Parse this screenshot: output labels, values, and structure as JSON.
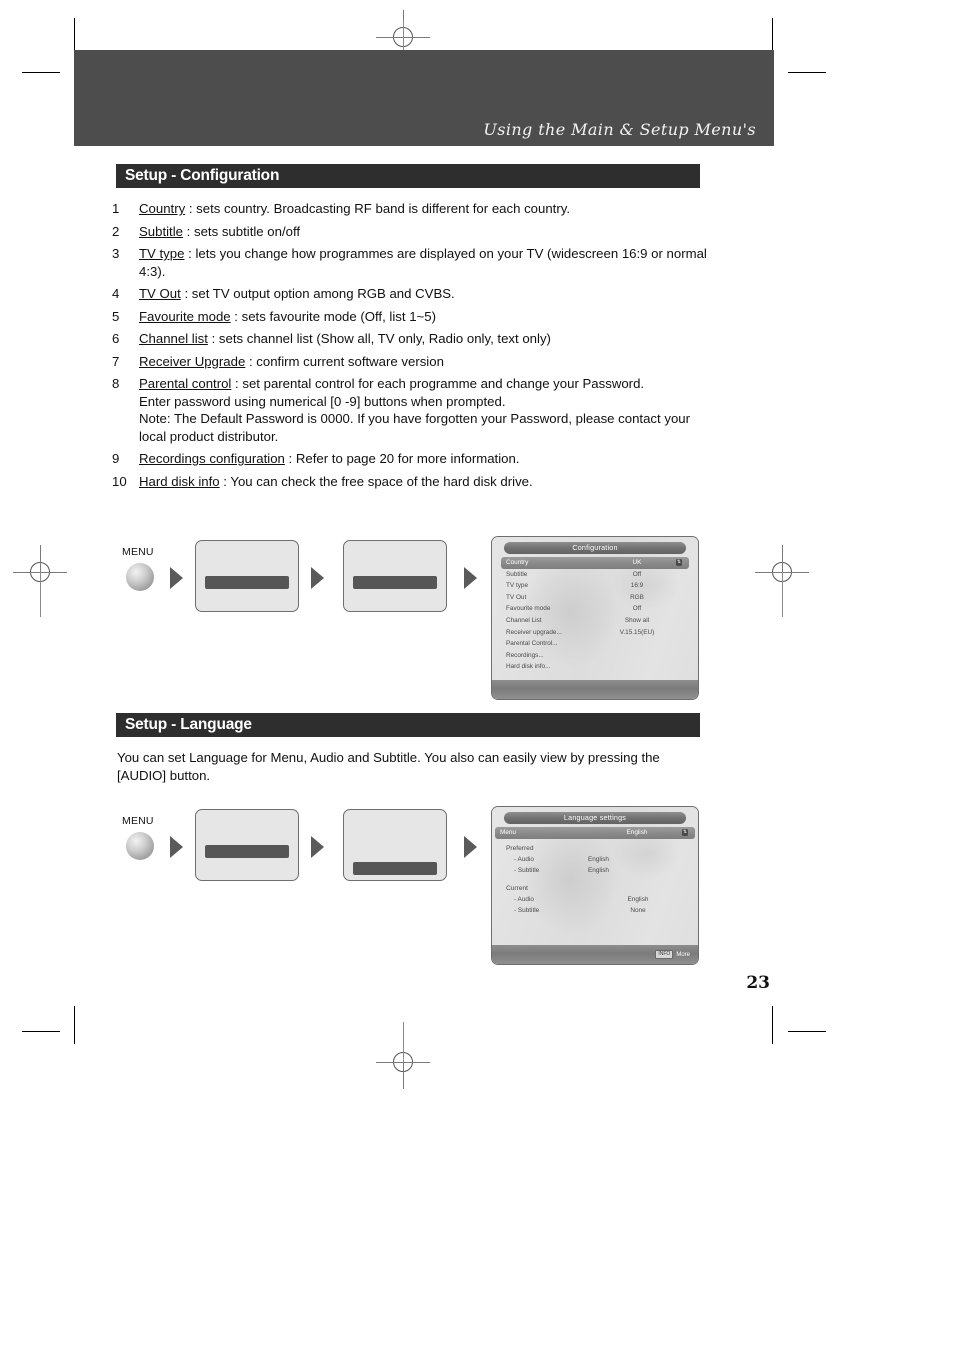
{
  "header": {
    "title": "Using the Main & Setup Menu's"
  },
  "sections": {
    "configuration": {
      "heading": "Setup - Configuration",
      "items": [
        {
          "num": "1",
          "term": "Country",
          "rest": " : sets country.  Broadcasting RF band is different for each country."
        },
        {
          "num": "2",
          "term": "Subtitle",
          "rest": " : sets subtitle on/off"
        },
        {
          "num": "3",
          "term": "TV type",
          "rest": " : lets you change how programmes are displayed on your TV (widescreen 16:9 or normal 4:3)."
        },
        {
          "num": "4",
          "term": "TV Out",
          "rest": " : set TV output option among RGB and CVBS."
        },
        {
          "num": "5",
          "term": "Favourite mode",
          "rest": " : sets favourite mode (Off, list 1~5)"
        },
        {
          "num": "6",
          "term": "Channel list",
          "rest": " : sets channel list (Show all, TV only, Radio only, text only)"
        },
        {
          "num": "7",
          "term": "Receiver Upgrade",
          "rest": " : confirm current software version"
        },
        {
          "num": "8",
          "term": "Parental control",
          "rest": " : set parental control for each programme and change your Password.",
          "extra": [
            "Enter password using numerical [0 -9] buttons when prompted.",
            "Note: The Default Password is 0000. If you have forgotten your Password, please contact your local product distributor."
          ]
        },
        {
          "num": "9",
          "term": "Recordings configuration",
          "rest": " : Refer to page 20 for more information."
        },
        {
          "num": "10",
          "term": "Hard disk info",
          "rest": " : You can check the free space of the hard disk drive."
        }
      ]
    },
    "language": {
      "heading": "Setup - Language",
      "paragraph": "You can set Language for Menu, Audio and Subtitle. You also can easily view by pressing the [AUDIO] button."
    }
  },
  "flow": {
    "menu_label": "MENU"
  },
  "osd_configuration": {
    "title": "Configuration",
    "rows": [
      {
        "key": "Country",
        "value": "UK",
        "selected": true
      },
      {
        "key": "Subtitle",
        "value": "Off",
        "selected": false
      },
      {
        "key": "TV type",
        "value": "16:9",
        "selected": false
      },
      {
        "key": "TV Out",
        "value": "RGB",
        "selected": false
      },
      {
        "key": "Favourite mode",
        "value": "Off",
        "selected": false
      },
      {
        "key": "Channel List",
        "value": "Show all",
        "selected": false
      },
      {
        "key": "Receiver upgrade...",
        "value": "V.15.15(EU)",
        "selected": false
      },
      {
        "key": "Parental Control...",
        "value": "",
        "selected": false
      },
      {
        "key": "Recordings...",
        "value": "",
        "selected": false
      },
      {
        "key": "Hard disk info...",
        "value": "",
        "selected": false
      }
    ]
  },
  "osd_language": {
    "title": "Language settings",
    "menu_row": {
      "key": "Menu",
      "value": "English"
    },
    "preferred": {
      "label": "Preferred",
      "lines": [
        {
          "key": "- Audio",
          "value": "English"
        },
        {
          "key": "- Subtitle",
          "value": "English"
        }
      ]
    },
    "current": {
      "label": "Current",
      "lines": [
        {
          "key": "- Audio",
          "value": "English"
        },
        {
          "key": "- Subtitle",
          "value": "None"
        }
      ]
    },
    "footer": {
      "keycap": "INFO",
      "label": "More"
    }
  },
  "page_number": "23"
}
